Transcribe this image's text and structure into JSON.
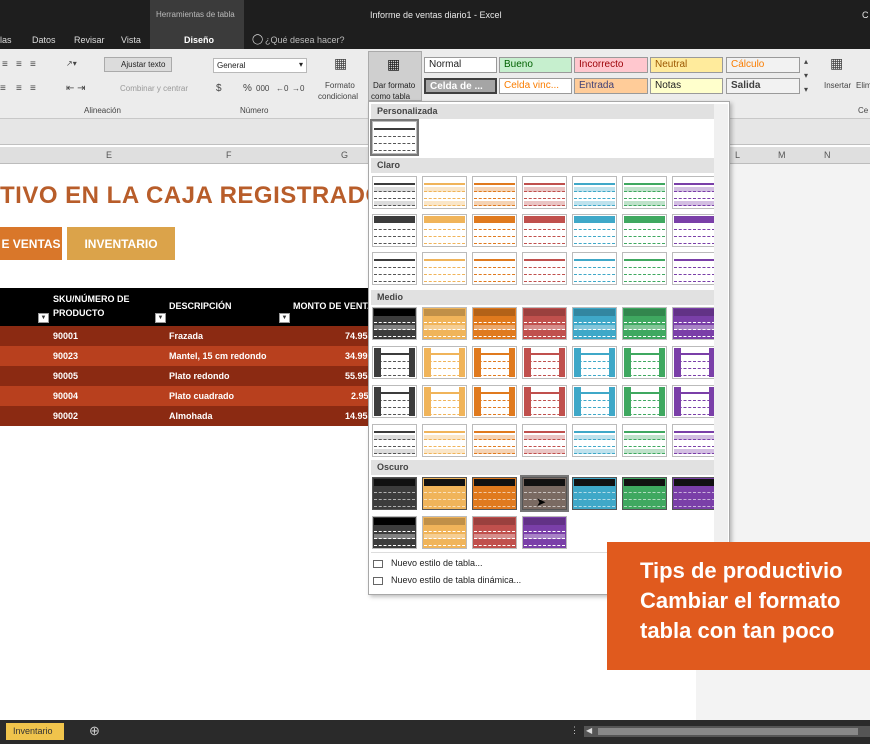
{
  "titlebar": {
    "context_tab": "Herramientas de tabla",
    "doc_title": "Informe de ventas diario1  -  Excel",
    "right_letter": "C"
  },
  "tabs": {
    "items": [
      "las",
      "Datos",
      "Revisar",
      "Vista",
      "Diseño"
    ],
    "tell_me": "¿Qué desea hacer?"
  },
  "ribbon": {
    "wrap_text": "Ajustar texto",
    "merge_center": "Combinar y centrar",
    "group_alignment": "Alineación",
    "number_format": "General",
    "currency": "$",
    "percent": "%",
    "thousands": "000",
    "group_number": "Número",
    "conditional_format": "Formato",
    "conditional_format2": "condicional",
    "format_table": "Dar formato",
    "format_table2": "como tabla",
    "insert": "Insertar",
    "delete": "Elim",
    "cells_group": "Ce",
    "styles": {
      "normal": "Normal",
      "bueno": "Bueno",
      "incorrecto": "Incorrecto",
      "neutral": "Neutral",
      "calculo": "Cálculo",
      "celda_de": "Celda de ...",
      "celda_vinc": "Celda vinc...",
      "entrada": "Entrada",
      "notas": "Notas",
      "salida": "Salida"
    }
  },
  "columns": [
    "E",
    "F",
    "G",
    "L",
    "M",
    "N"
  ],
  "sheet": {
    "title": "TIVO EN LA CAJA REGISTRADO",
    "btn_ventas": "E VENTAS",
    "btn_inventario": "INVENTARIO",
    "headers": {
      "sku": "SKU/NÚMERO DE",
      "sku2": "PRODUCTO",
      "descripcion": "DESCRIPCIÓN",
      "monto": "MONTO DE VENTA"
    },
    "rows": [
      {
        "sku": "90001",
        "desc": "Frazada",
        "monto": "74.95"
      },
      {
        "sku": "90023",
        "desc": "Mantel, 15 cm redondo",
        "monto": "34.99"
      },
      {
        "sku": "90005",
        "desc": "Plato redondo",
        "monto": "55.95"
      },
      {
        "sku": "90004",
        "desc": "Plato cuadrado",
        "monto": "2.95"
      },
      {
        "sku": "90002",
        "desc": "Almohada",
        "monto": "14.95"
      }
    ]
  },
  "gallery": {
    "sec_custom": "Personalizada",
    "sec_light": "Claro",
    "sec_medium": "Medio",
    "sec_dark": "Oscuro",
    "menu_new_style": "Nuevo estilo de tabla...",
    "menu_new_pivot": "Nuevo estilo de tabla dinámica..."
  },
  "sheettabs": {
    "active": "Inventario",
    "add": "⊕"
  },
  "overlay": {
    "line1": "Tips de productivio",
    "line2": "Cambiar el formato",
    "line3": "tabla con tan poco"
  },
  "colors": {
    "accent_orange": "#e05a1e",
    "row_dark": "#8b2a12",
    "row_light": "#b8401e",
    "title_orange": "#b85d2a",
    "btn_orange": "#d9772a",
    "btn_gold": "#dba34a"
  },
  "swatch_palette": [
    "#3c3c3c",
    "#f0b45a",
    "#e07a1e",
    "#c0504d",
    "#3fa8c8",
    "#3fa860",
    "#7a3fa8"
  ]
}
